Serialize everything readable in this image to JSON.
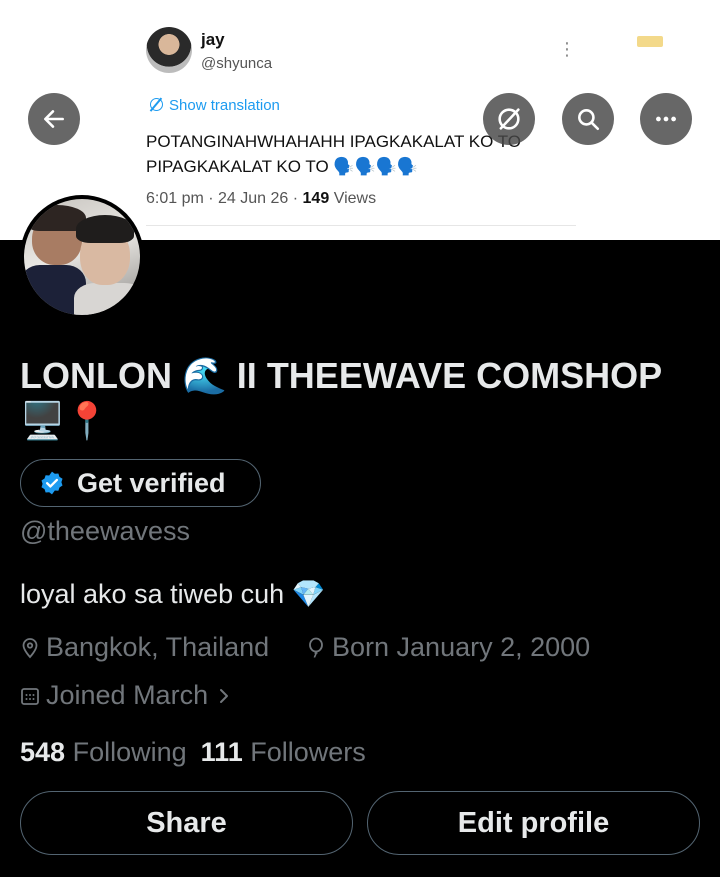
{
  "banner_tweet": {
    "author_name": "jay",
    "author_handle": "@shyunca",
    "translate_label": "Show translation",
    "text": "POTANGINAHWHAHAHH IPAGKAKALAT KO TO PIPAGKAKALAT KO TO 🗣️🗣️🗣️🗣️",
    "time": "6:01 pm",
    "date": "24 Jun 26",
    "views_count": "149",
    "views_label": "Views",
    "more_glyph": "⋮"
  },
  "header": {
    "back_icon": "arrow-left-icon",
    "grok_icon": "grok-icon",
    "search_icon": "search-icon",
    "more_icon": "more-horizontal-icon"
  },
  "profile": {
    "display_name": "LONLON 🌊 II THEEWAVE COMSHOP 🖥️📍",
    "verify_label": "Get verified",
    "handle": "@theewavess",
    "bio": "loyal ako sa tiweb cuh 💎",
    "location": "Bangkok, Thailand",
    "born": "Born January 2, 2000",
    "joined": "Joined March",
    "following_count": "548",
    "following_label": "Following",
    "followers_count": "111",
    "followers_label": "Followers",
    "share_label": "Share",
    "edit_label": "Edit profile"
  },
  "colors": {
    "accent": "#1d9bf0",
    "background": "#000000",
    "text_primary": "#e7e9ea",
    "text_secondary": "#71767b",
    "border": "#536471"
  }
}
